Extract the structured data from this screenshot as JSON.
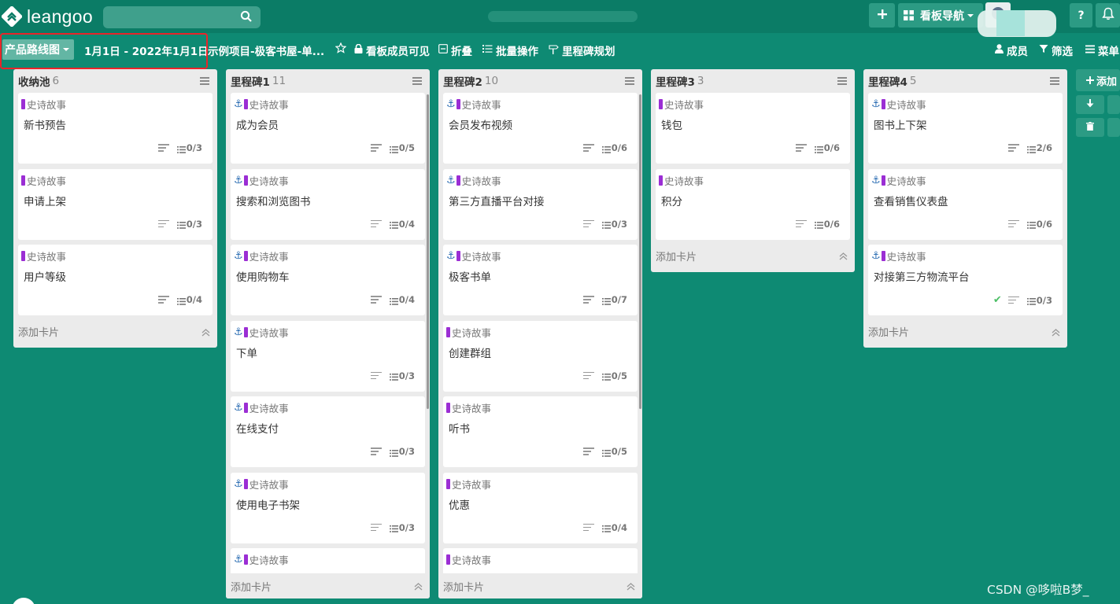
{
  "app": {
    "logo_text": "leangoo"
  },
  "header": {
    "search_placeholder": "",
    "board_nav_label": "看板导航",
    "help_label": "?"
  },
  "subbar": {
    "view_label": "产品路线图",
    "date_range": "1月1日 - 2022年1月1日",
    "project_name": "示例项目-极客书屋-单...",
    "members_visible": "看板成员可见",
    "collapse": "折叠",
    "batch": "批量操作",
    "milestone_plan": "里程碑规划",
    "members": "成员",
    "filter": "筛选",
    "menu": "菜单"
  },
  "columns": [
    {
      "title": "收纳池",
      "count": "6",
      "add_label": "添加卡片",
      "cards": [
        {
          "tag": "史诗故事",
          "title": "新书预告",
          "progress": "0/3",
          "anchor": false,
          "done": false
        },
        {
          "tag": "史诗故事",
          "title": "申请上架",
          "progress": "0/3",
          "anchor": false,
          "done": false
        },
        {
          "tag": "史诗故事",
          "title": "用户等级",
          "progress": "0/4",
          "anchor": false,
          "done": false
        }
      ]
    },
    {
      "title": "里程碑1",
      "count": "11",
      "add_label": "添加卡片",
      "cards": [
        {
          "tag": "史诗故事",
          "title": "成为会员",
          "progress": "0/5",
          "anchor": true,
          "done": false
        },
        {
          "tag": "史诗故事",
          "title": "搜索和浏览图书",
          "progress": "0/4",
          "anchor": true,
          "done": false
        },
        {
          "tag": "史诗故事",
          "title": "使用购物车",
          "progress": "0/4",
          "anchor": true,
          "done": false
        },
        {
          "tag": "史诗故事",
          "title": "下单",
          "progress": "0/3",
          "anchor": true,
          "done": false
        },
        {
          "tag": "史诗故事",
          "title": "在线支付",
          "progress": "0/3",
          "anchor": true,
          "done": false
        },
        {
          "tag": "史诗故事",
          "title": "使用电子书架",
          "progress": "0/3",
          "anchor": true,
          "done": false
        },
        {
          "tag": "史诗故事",
          "title": "",
          "progress": "",
          "anchor": true,
          "done": false
        }
      ]
    },
    {
      "title": "里程碑2",
      "count": "10",
      "add_label": "添加卡片",
      "cards": [
        {
          "tag": "史诗故事",
          "title": "会员发布视频",
          "progress": "0/6",
          "anchor": true,
          "done": false
        },
        {
          "tag": "史诗故事",
          "title": "第三方直播平台对接",
          "progress": "0/3",
          "anchor": true,
          "done": false
        },
        {
          "tag": "史诗故事",
          "title": "极客书单",
          "progress": "0/7",
          "anchor": true,
          "done": false
        },
        {
          "tag": "史诗故事",
          "title": "创建群组",
          "progress": "0/5",
          "anchor": false,
          "done": false
        },
        {
          "tag": "史诗故事",
          "title": "听书",
          "progress": "0/5",
          "anchor": false,
          "done": false
        },
        {
          "tag": "史诗故事",
          "title": "优惠",
          "progress": "0/4",
          "anchor": false,
          "done": false
        },
        {
          "tag": "史诗故事",
          "title": "",
          "progress": "",
          "anchor": false,
          "done": false
        }
      ]
    },
    {
      "title": "里程碑3",
      "count": "3",
      "add_label": "添加卡片",
      "cards": [
        {
          "tag": "史诗故事",
          "title": "钱包",
          "progress": "0/6",
          "anchor": false,
          "done": false
        },
        {
          "tag": "史诗故事",
          "title": "积分",
          "progress": "0/6",
          "anchor": false,
          "done": false
        }
      ]
    },
    {
      "title": "里程碑4",
      "count": "5",
      "add_label": "添加卡片",
      "cards": [
        {
          "tag": "史诗故事",
          "title": "图书上下架",
          "progress": "2/6",
          "anchor": true,
          "done": false
        },
        {
          "tag": "史诗故事",
          "title": "查看销售仪表盘",
          "progress": "0/6",
          "anchor": true,
          "done": false
        },
        {
          "tag": "史诗故事",
          "title": "对接第三方物流平台",
          "progress": "0/3",
          "anchor": true,
          "done": true
        }
      ]
    }
  ],
  "right_panel": {
    "add_label": "添加"
  },
  "watermark": "CSDN @哆啦B梦_",
  "colors": {
    "background": "#0e8a73",
    "tag_purple": "#9b2ed4",
    "highlight_red": "#e8252a"
  }
}
